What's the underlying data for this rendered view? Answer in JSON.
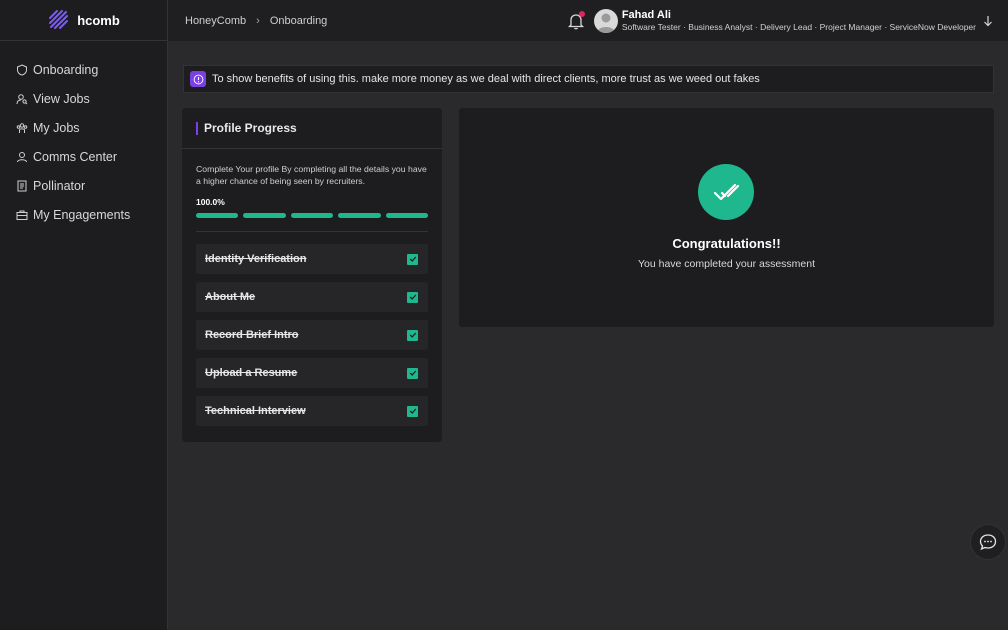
{
  "app": {
    "logo_text": "hcomb"
  },
  "sidebar": {
    "items": [
      {
        "label": "Onboarding",
        "icon": "shield-icon"
      },
      {
        "label": "View Jobs",
        "icon": "user-search-icon"
      },
      {
        "label": "My Jobs",
        "icon": "team-icon"
      },
      {
        "label": "Comms Center",
        "icon": "user-icon"
      },
      {
        "label": "Pollinator",
        "icon": "document-icon"
      },
      {
        "label": "My Engagements",
        "icon": "briefcase-icon"
      }
    ]
  },
  "breadcrumb": [
    "HoneyComb",
    "Onboarding"
  ],
  "user": {
    "name": "Fahad Ali",
    "roles": "Software Tester · Business Analyst · Delivery Lead · Project Manager · ServiceNow Developer"
  },
  "banner": {
    "text": "To show benefits of using this. make more money as we deal with direct clients, more trust as we weed out fakes"
  },
  "profile_progress": {
    "title": "Profile Progress",
    "description": "Complete Your profile By completing all the details you have a higher chance of being seen by recruiters.",
    "percent_label": "100.0%",
    "segments_filled": [
      1,
      1,
      1,
      1,
      1
    ],
    "tasks": [
      {
        "label": "Identity Verification",
        "done": true
      },
      {
        "label": "About Me",
        "done": true
      },
      {
        "label": "Record Brief Intro",
        "done": true
      },
      {
        "label": "Upload a Resume",
        "done": true
      },
      {
        "label": "Technical Interview",
        "done": true
      }
    ]
  },
  "congrats": {
    "title": "Congratulations!!",
    "subtitle": "You have completed your assessment"
  },
  "colors": {
    "accent": "#7b3fe4",
    "success": "#1fb88e",
    "notify": "#e0245e"
  }
}
